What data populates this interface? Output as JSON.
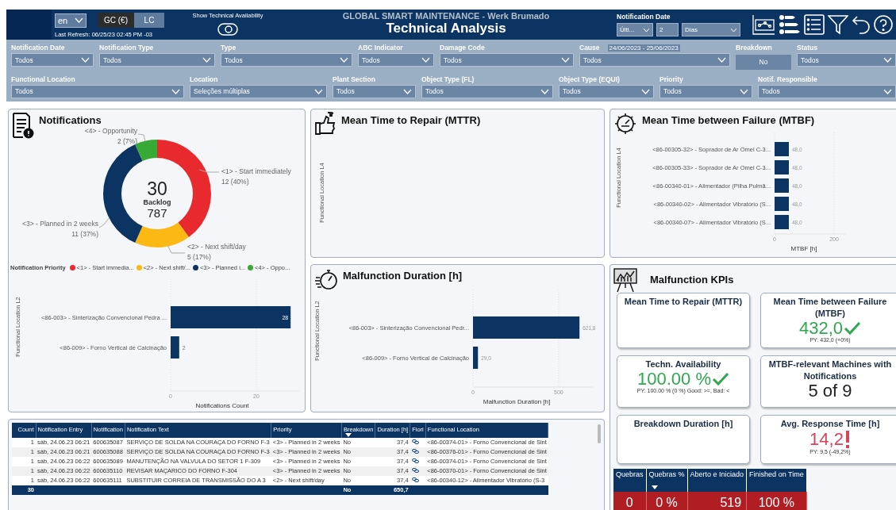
{
  "header": {
    "language": "en",
    "currency_buttons": [
      {
        "label": "GC (€)",
        "selected": true
      },
      {
        "label": "LC",
        "selected": false
      }
    ],
    "last_refresh": "Last Refresh: 06/25/23 02:45 PM -03",
    "toggle": {
      "label": "Show Technical Availability",
      "on": false
    },
    "subtitle": "GLOBAL SMART MAINTENANCE - Werk Brumado",
    "title": "Technical Analysis",
    "date_filter": {
      "label": "Notification Date",
      "mode": "Últi...",
      "amount": "2",
      "unit": "Dias"
    }
  },
  "filters": [
    [
      {
        "kind": "dropdown",
        "label": "Notification Date",
        "value": "Todos"
      },
      {
        "kind": "dropdown",
        "label": "Notification Type",
        "value": "Todos"
      },
      {
        "kind": "dropdown",
        "label": "Type",
        "value": "Todos"
      },
      {
        "kind": "dropdown",
        "label": "ABC Indicator",
        "value": "Todos"
      },
      {
        "kind": "dropdown",
        "label": "Damage Code",
        "value": "Todos"
      },
      {
        "kind": "dropdown",
        "label": "Cause",
        "value": "Todos",
        "range": "24/06/2023 - 25/06/2023"
      },
      {
        "kind": "button",
        "label": "Breakdown",
        "value": "No"
      },
      {
        "kind": "dropdown",
        "label": "Status",
        "value": "Todos"
      }
    ],
    [
      {
        "kind": "dropdown",
        "label": "Functional Location",
        "value": "Todos"
      },
      {
        "kind": "dropdown",
        "label": "Location",
        "value": "Seleções múltiplas"
      },
      {
        "kind": "dropdown",
        "label": "Plant Section",
        "value": "Todos"
      },
      {
        "kind": "dropdown",
        "label": "Object Type (FL)",
        "value": "Todos"
      },
      {
        "kind": "dropdown",
        "label": "Object Type (EQUI)",
        "value": "Todos"
      },
      {
        "kind": "dropdown",
        "label": "Priority",
        "value": "Todos"
      },
      {
        "kind": "dropdown",
        "label": "Notif. Responsible",
        "value": "Todos"
      }
    ]
  ],
  "notifications": {
    "title": "Notifications",
    "donut": {
      "chart_data": {
        "type": "donut",
        "categories": [
          "<1> - Start immediately",
          "<2> - Next shift/day",
          "<3> - Planned in 2 weeks",
          "<4> - Opportunity"
        ],
        "series": [
          {
            "values": [
              40,
              16.7,
              36.6,
              6.7
            ]
          }
        ],
        "value_labels": [
          "12 (40%)",
          "5 (17%)",
          "11 (37%)",
          "2 (7%)"
        ]
      },
      "center": {
        "value": "30",
        "label": "Backlog",
        "sub_value": "787"
      }
    },
    "legend": {
      "title": "Notification Priority",
      "items": [
        {
          "label": "<1> - Start immedia...",
          "color": "#e8292e"
        },
        {
          "label": "<2> - Next shift/...",
          "color": "#fdb913"
        },
        {
          "label": "<3> - Planned i...",
          "color": "#0b3462"
        },
        {
          "label": "<4> - Oppo...",
          "color": "#37a935"
        }
      ]
    },
    "bar": {
      "chart_data": {
        "type": "bar",
        "orientation": "horizontal",
        "ylabel": "Functional Location L2",
        "xlabel": "Notifications Count",
        "categories": [
          "<86-003> - Sinterização Convencional Pedra ...",
          "<86-009> - Forno Vertical de Calcinação"
        ],
        "series": [
          {
            "color": "#0b3462",
            "values": [
              28,
              2
            ]
          }
        ],
        "value_labels": [
          "28",
          "2"
        ],
        "xlim": [
          0,
          30
        ],
        "xticks": [
          0,
          20
        ]
      }
    }
  },
  "mttr": {
    "title": "Mean Time to Repair (MTTR)",
    "axis_label": "Functional Location L4"
  },
  "mtbf": {
    "title": "Mean Time between Failure (MTBF)",
    "chart_data": {
      "type": "bar",
      "orientation": "horizontal",
      "ylabel": "Functional Location L4",
      "xlabel": "MTBF [h]",
      "categories": [
        "<86-00305-32> - Soprador de Ar Omel C-3...",
        "<86-00305-33> - Soprador de Ar Omel C-3...",
        "<86-00340-01> - Alimentador (Pilha Pulmã...",
        "<86-00340-02> - Alimentador Vibratório (S...",
        "<86-00340-07> - Alimentador Vibratório (S..."
      ],
      "series": [
        {
          "color": "#0b3462",
          "values": [
            48,
            48,
            48,
            48,
            48
          ]
        }
      ],
      "value_labels": [
        "48,0",
        "48,0",
        "48,0",
        "48,0",
        "48,0"
      ],
      "xlim": [
        0,
        240
      ],
      "xticks": [
        0,
        200
      ]
    }
  },
  "malfunction": {
    "title": "Malfunction Duration [h]",
    "chart_data": {
      "type": "bar",
      "orientation": "horizontal",
      "ylabel": "Functional Location L2",
      "xlabel": "Malfunction Duration [h]",
      "categories": [
        "<86-003> - Sinterização Convencional Pedr...",
        "<86-009> - Forno Vertical de Calcinação"
      ],
      "series": [
        {
          "color": "#0b3462",
          "values": [
            622,
            29
          ]
        }
      ],
      "value_labels": [
        "621,8",
        "29,0"
      ],
      "xlim": [
        0,
        700
      ],
      "xticks": [
        0,
        500
      ]
    }
  },
  "kpis": {
    "title": "Malfunction KPIs",
    "cards": [
      {
        "title": "Mean Time to Repair (MTTR)"
      },
      {
        "title": "Mean Time between Failure (MTBF)",
        "value": "432,0",
        "kind": "good",
        "note": "PY: 432,0 (+0%)"
      },
      {
        "title": "Techn. Availability",
        "value": "100.00 %",
        "kind": "good",
        "note": "PY: 100.00 % (0 %) Good: >=, Bad: <"
      },
      {
        "title": "MTBF-relevant Machines with Notifications",
        "value": "5 of 9",
        "kind": "plain"
      },
      {
        "title": "Breakdown Duration [h]"
      },
      {
        "title": "Avg. Response Time [h]",
        "value": "14,2",
        "kind": "bad",
        "note": "PY: 9,5 (-49,2%)"
      }
    ],
    "summary": {
      "columns": [
        {
          "label": "Quebras",
          "sorted": false
        },
        {
          "label": "Quebras %",
          "sorted": true
        },
        {
          "label": "Aberto e Iniciado",
          "sorted": false
        },
        {
          "label": "Finished on Time",
          "sorted": false
        }
      ],
      "row": [
        "0",
        "0 %",
        "519",
        "100 %"
      ]
    }
  },
  "table": {
    "columns": [
      {
        "label": "Count",
        "sorted": false,
        "total": "30"
      },
      {
        "label": "Notification Entry",
        "sorted": false
      },
      {
        "label": "Notification",
        "sorted": false
      },
      {
        "label": "Notification Text",
        "sorted": false
      },
      {
        "label": "Priority",
        "sorted": false
      },
      {
        "label": "Breakdown",
        "sorted": true,
        "total": "No"
      },
      {
        "label": "Duration [h]",
        "sorted": false,
        "total": "650,7"
      },
      {
        "label": "Fiori",
        "sorted": false,
        "kind": "icon"
      },
      {
        "label": "Functional Location",
        "sorted": false
      }
    ],
    "rows": [
      [
        "1",
        "sáb, 24.06.23 06:21",
        "600635087",
        "SERVIÇO DE SOLDA NA COURAÇA DO FORNO F-3",
        "<3> - Planned in 2 weeks",
        "No",
        "37,4",
        "<86-00374-01> - Forno Convencional de Sint"
      ],
      [
        "1",
        "sáb, 24.06.23 06:21",
        "600635088",
        "SERVIÇO DE SOLDA NA COURAÇA DO FORNO F-3",
        "<3> - Planned in 2 weeks",
        "No",
        "37,4",
        "<86-00376-01> - Forno Convencional de Sint"
      ],
      [
        "1",
        "sáb, 24.06.23 06:22",
        "600635089",
        "MANUTENÇÃO NA VALVULA DO SETOR 1 F-309",
        "<3> - Planned in 2 weeks",
        "No",
        "37,4",
        "<86-00374-01> - Forno Convencional de Sint"
      ],
      [
        "1",
        "sáb, 24.06.23 06:22",
        "600635110",
        "REVISAR MAÇARICO DO FORNO F-304",
        "<3> - Planned in 2 weeks",
        "No",
        "37,4",
        "<86-00370-01> - Forno Convencional de Sint"
      ],
      [
        "1",
        "sáb, 24.06.23 06:22",
        "600635111",
        "SUBSTITUIR CORREIA DE TRANSMISSÃO DO A 3",
        "<2> - Next shift/day",
        "No",
        "37,4",
        "<86-00340-12> - Alimentador Vibratório (S-3"
      ]
    ]
  }
}
